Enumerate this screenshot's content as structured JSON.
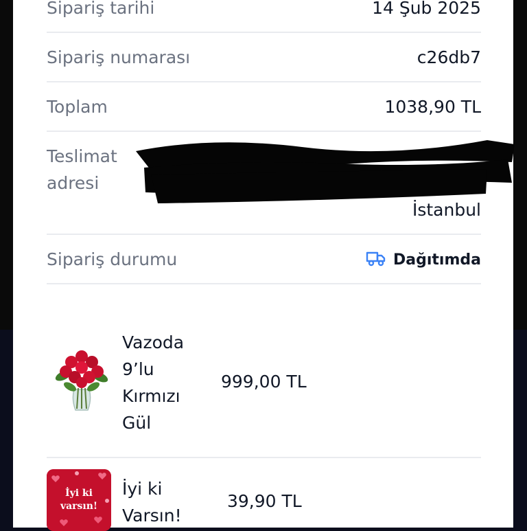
{
  "order": {
    "date_label": "Sipariş tarihi",
    "date_value": "14 Şub 2025",
    "number_label": "Sipariş numarası",
    "number_value": "c26db7",
    "total_label": "Toplam",
    "total_value": "1038,90 TL",
    "address_label_line1": "Teslimat",
    "address_label_line2": "adresi",
    "address_city": "İstanbul",
    "status_label": "Sipariş durumu",
    "status_value": "Dağıtımda",
    "status_icon": "truck-icon"
  },
  "products": [
    {
      "name_lines": [
        "Vazoda",
        "9’lu",
        "Kırmızı",
        "Gül"
      ],
      "price": "999,00 TL",
      "image": "red-roses-vase-image"
    },
    {
      "name_lines": [
        "İyi ki",
        "Varsın!"
      ],
      "price": "39,90 TL",
      "image_text_line1": "İyi ki",
      "image_text_line2": "varsın!",
      "image": "greeting-card-image"
    }
  ],
  "colors": {
    "accent": "#3b82f6",
    "label": "#6b7280",
    "divider": "#e9ebef"
  }
}
